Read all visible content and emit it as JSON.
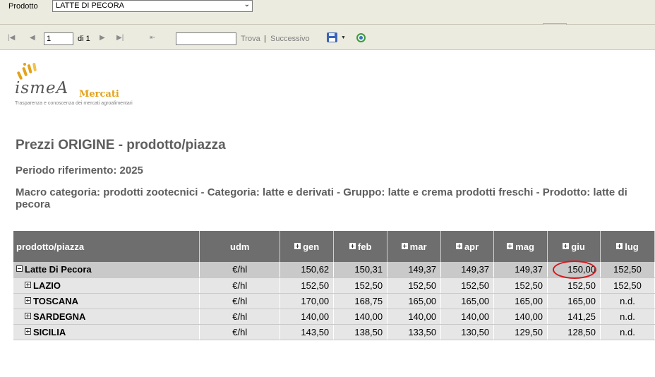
{
  "params": {
    "product_label": "Prodotto",
    "product_value": "LATTE DI PECORA"
  },
  "toolbar": {
    "page_value": "1",
    "page_of": "di 1",
    "find_label": "Trova",
    "separator": "|",
    "next_label": "Successivo"
  },
  "logo": {
    "wordmark": "ismeA",
    "subbrand": "Mercati",
    "tagline": "Trasparenza e conoscenza dei mercati agroalimentari"
  },
  "report": {
    "title": "Prezzi ORIGINE - prodotto/piazza",
    "period": "Periodo riferimento: 2025",
    "category": "Macro categoria: prodotti zootecnici - Categoria: latte e derivati - Gruppo: latte e crema prodotti freschi - Prodotto: latte di pecora"
  },
  "table": {
    "headers": [
      "prodotto/piazza",
      "udm",
      "gen",
      "feb",
      "mar",
      "apr",
      "mag",
      "giu",
      "lug"
    ],
    "rows": [
      {
        "name": "Latte Di Pecora",
        "udm": "€/hl",
        "values": [
          "150,62",
          "150,31",
          "149,37",
          "149,37",
          "149,37",
          "150,00",
          "152,50"
        ]
      },
      {
        "name": "LAZIO",
        "udm": "€/hl",
        "values": [
          "152,50",
          "152,50",
          "152,50",
          "152,50",
          "152,50",
          "152,50",
          "152,50"
        ]
      },
      {
        "name": "TOSCANA",
        "udm": "€/hl",
        "values": [
          "170,00",
          "168,75",
          "165,00",
          "165,00",
          "165,00",
          "165,00",
          "n.d."
        ]
      },
      {
        "name": "SARDEGNA",
        "udm": "€/hl",
        "values": [
          "140,00",
          "140,00",
          "140,00",
          "140,00",
          "140,00",
          "141,25",
          "n.d."
        ]
      },
      {
        "name": "SICILIA",
        "udm": "€/hl",
        "values": [
          "143,50",
          "138,50",
          "133,50",
          "130,50",
          "129,50",
          "128,50",
          "n.d."
        ]
      }
    ]
  },
  "colors": {
    "header_bg": "#6e6e6e",
    "highlight_circle": "#d8161d",
    "logo_accent": "#e3a21a"
  }
}
